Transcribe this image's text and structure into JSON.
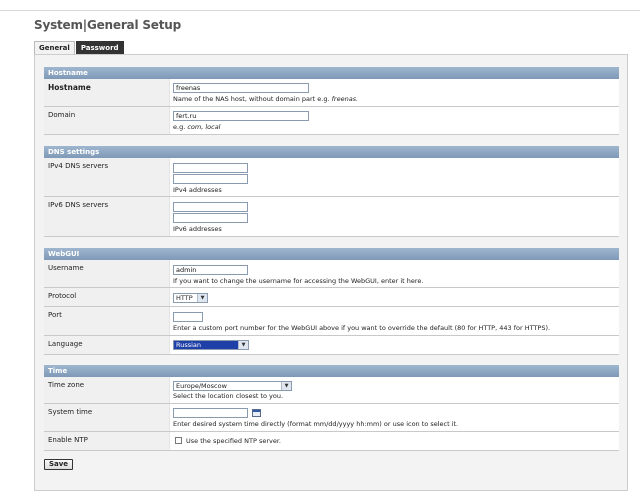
{
  "page": {
    "title": "System|General Setup"
  },
  "tabs": [
    {
      "label": "General",
      "active": false
    },
    {
      "label": "Password",
      "active": true
    }
  ],
  "sections": {
    "hostname": {
      "header": "Hostname",
      "hostname_label": "Hostname",
      "hostname_value": "freenas",
      "hostname_hint": "Name of the NAS host, without domain part e.g. ",
      "hostname_hint_example": "freenas.",
      "domain_label": "Domain",
      "domain_value": "fert.ru",
      "domain_hint_prefix": "e.g. ",
      "domain_hint_example": "com, local"
    },
    "dns": {
      "header": "DNS settings",
      "ipv4_label": "IPv4 DNS servers",
      "ipv4_value1": "",
      "ipv4_value2": "",
      "ipv4_hint": "IPv4 addresses",
      "ipv6_label": "IPv6 DNS servers",
      "ipv6_value1": "",
      "ipv6_value2": "",
      "ipv6_hint": "IPv6 addresses"
    },
    "webgui": {
      "header": "WebGUI",
      "username_label": "Username",
      "username_value": "admin",
      "username_hint": "If you want to change the username for accessing the WebGUI, enter it here.",
      "protocol_label": "Protocol",
      "protocol_value": "HTTP",
      "port_label": "Port",
      "port_value": "",
      "port_hint": "Enter a custom port number for the WebGUI above if you want to override the default (80 for HTTP, 443 for HTTPS).",
      "language_label": "Language",
      "language_value": "Russian"
    },
    "time": {
      "header": "Time",
      "timezone_label": "Time zone",
      "timezone_value": "Europe/Moscow",
      "timezone_hint": "Select the location closest to you.",
      "systemtime_label": "System time",
      "systemtime_value": "",
      "systemtime_hint": "Enter desired system time directly (format mm/dd/yyyy hh:mm) or use icon to select it.",
      "ntp_label": "Enable NTP",
      "ntp_checkbox_label": "Use the specified NTP server.",
      "ntp_checked": false
    }
  },
  "actions": {
    "save_label": "Save"
  },
  "colors": {
    "section_header": "#8aa3bf",
    "active_tab": "#333333",
    "selected_language_bg": "#1f3fa8"
  },
  "icons": {
    "calendar": "calendar-icon",
    "dropdown": "chevron-down-icon"
  }
}
